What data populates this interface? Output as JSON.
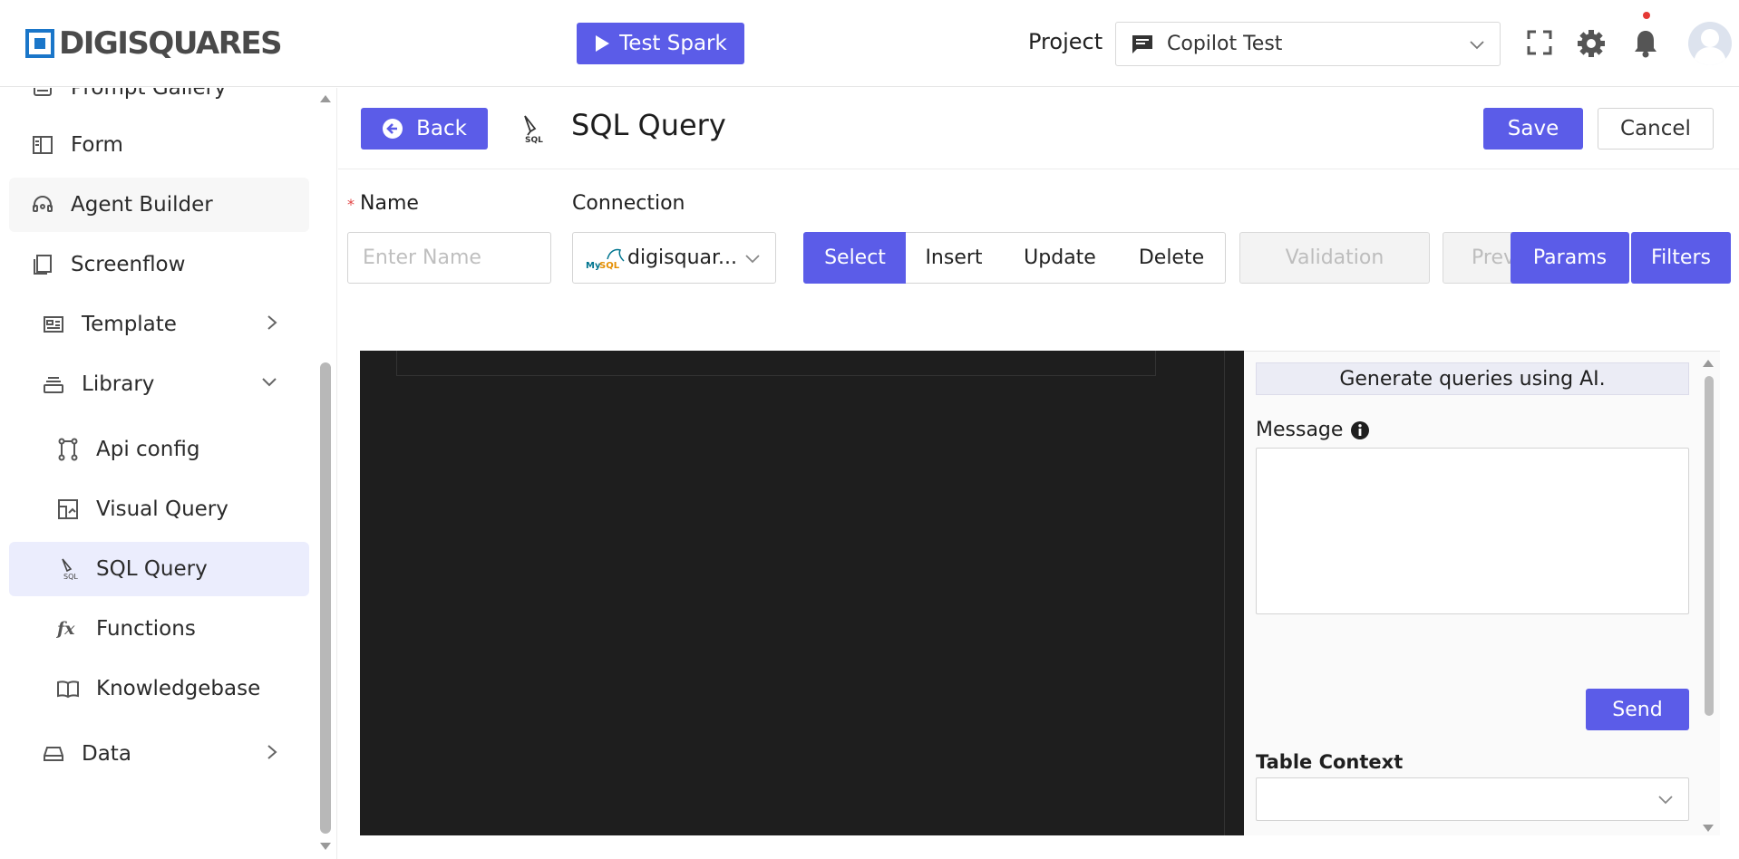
{
  "header": {
    "logo_text": "DIGISQUARES",
    "test_spark_label": "Test Spark",
    "project_label": "Project",
    "project_value": "Copilot Test"
  },
  "sidebar": {
    "items": [
      {
        "label": "Prompt Gallery",
        "icon": "gallery-icon"
      },
      {
        "label": "Form",
        "icon": "form-icon"
      },
      {
        "label": "Agent Builder",
        "icon": "headset-icon"
      },
      {
        "label": "Screenflow",
        "icon": "screenflow-icon"
      },
      {
        "label": "Template",
        "icon": "template-icon"
      },
      {
        "label": "Library",
        "icon": "library-icon"
      },
      {
        "label": "Api config",
        "icon": "api-config-icon"
      },
      {
        "label": "Visual Query",
        "icon": "visual-query-icon"
      },
      {
        "label": "SQL Query",
        "icon": "sql-icon"
      },
      {
        "label": "Functions",
        "icon": "function-icon"
      },
      {
        "label": "Knowledgebase",
        "icon": "book-icon"
      },
      {
        "label": "Data",
        "icon": "drive-icon"
      }
    ]
  },
  "toolbar": {
    "back_label": "Back",
    "title": "SQL Query",
    "save_label": "Save",
    "cancel_label": "Cancel"
  },
  "form": {
    "name_label": "Name",
    "name_placeholder": "Enter Name",
    "connection_label": "Connection",
    "connection_value": "digisquar...",
    "query_types": [
      "Select",
      "Insert",
      "Update",
      "Delete"
    ],
    "active_query_type": "Select",
    "validation_label": "Validation",
    "preview_label": "Prev",
    "params_label": "Params",
    "filters_label": "Filters"
  },
  "ai_panel": {
    "banner": "Generate queries using AI.",
    "message_label": "Message",
    "send_label": "Send",
    "table_context_label": "Table Context"
  },
  "colors": {
    "accent": "#5b5ce8",
    "logo_blue": "#1a76c9",
    "editor_bg": "#1e1e1e",
    "active_nav_bg": "#ebedfd"
  }
}
